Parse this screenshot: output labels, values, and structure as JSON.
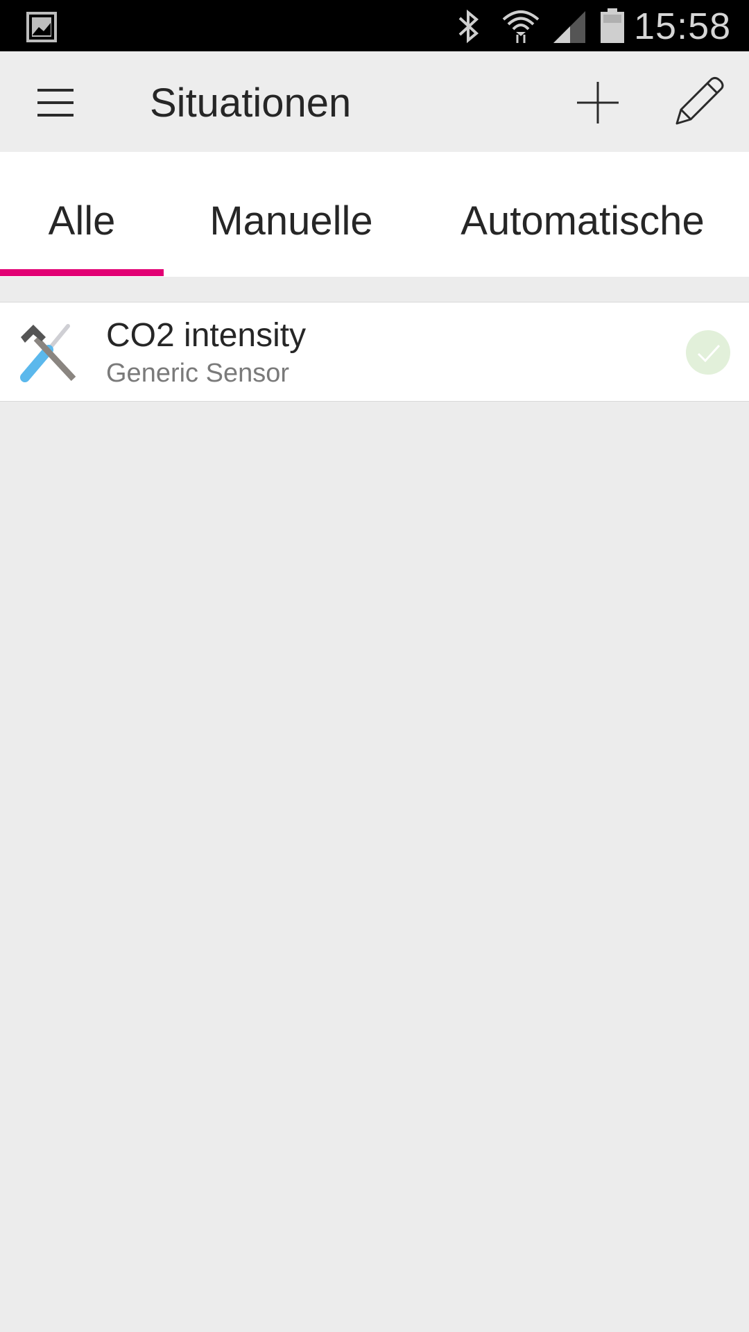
{
  "status_bar": {
    "time": "15:58",
    "icons": [
      "gallery-icon",
      "bluetooth-icon",
      "wifi-icon",
      "signal-icon",
      "battery-icon"
    ]
  },
  "app_bar": {
    "title": "Situationen",
    "menu_icon": "hamburger-menu-icon",
    "add_icon": "plus-icon",
    "edit_icon": "pencil-icon"
  },
  "tabs": [
    {
      "label": "Alle",
      "selected": true
    },
    {
      "label": "Manuelle",
      "selected": false
    },
    {
      "label": "Automatische",
      "selected": false
    }
  ],
  "colors": {
    "accent": "#e20074",
    "status_ok": "#e2f0da",
    "background": "#ececec"
  },
  "situations": [
    {
      "title": "CO2 intensity",
      "subtitle": "Generic Sensor",
      "icon": "tools-icon",
      "status_icon": "check-icon"
    }
  ]
}
